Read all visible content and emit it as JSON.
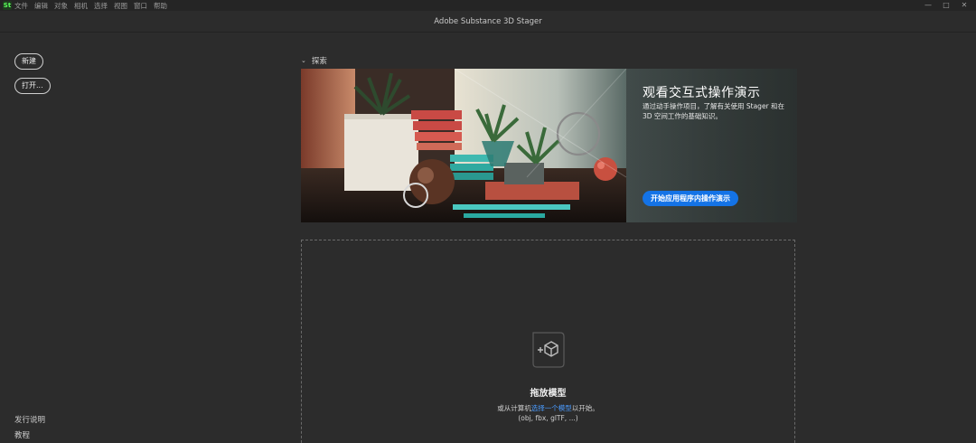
{
  "menubar": {
    "logo": "St",
    "items": [
      "文件",
      "编辑",
      "对象",
      "相机",
      "选择",
      "视图",
      "窗口",
      "帮助"
    ]
  },
  "window": {
    "title": "Adobe Substance 3D Stager",
    "controls": [
      "—",
      "□",
      "✕"
    ]
  },
  "sidebar": {
    "new_label": "新建",
    "open_label": "打开...",
    "release_notes": "发行说明",
    "tutorials": "教程"
  },
  "explore": {
    "label": "探索",
    "chevron": "⌄"
  },
  "banner": {
    "title": "观看交互式操作演示",
    "description": "通过动手操作项目，了解有关使用 Stager 和在 3D 空间工作的基础知识。",
    "cta_label": "开始应用程序内操作演示",
    "accent": "#1473e6"
  },
  "dropzone": {
    "icon": "add-model-icon",
    "title": "拖放模型",
    "sub_prefix": "或从计算机",
    "sub_link": "选择一个模型",
    "sub_suffix": "以开始。",
    "extensions": "(obj, fbx, glTF, ...)"
  }
}
